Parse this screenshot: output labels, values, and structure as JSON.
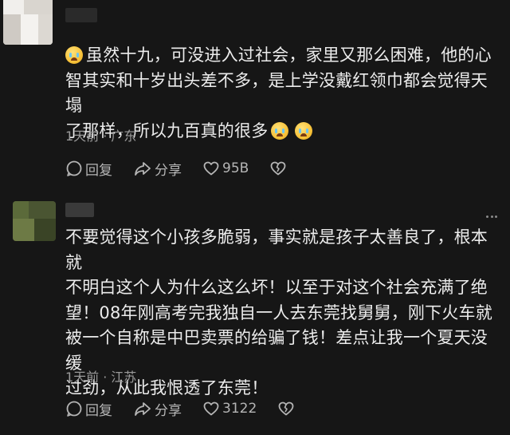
{
  "comments": [
    {
      "lines": [
        "虽然十九，可没进入过社会，家里又那么困难，他的心",
        "智其实和十岁出头差不多，是上学没戴红领巾都会觉得天塌",
        "了那样，所以九百真的很多"
      ],
      "time": "1天前",
      "location": "广东",
      "reply_label": "回复",
      "share_label": "分享",
      "like_count": "95B",
      "emoji_name": "crying-face-icon"
    },
    {
      "lines": [
        "不要觉得这个小孩多脆弱，事实就是孩子太善良了，根本就",
        "不明白这个人为什么这么坏！以至于对这个社会充满了绝",
        "望！08年刚高考完我独自一人去东莞找舅舅，刚下火车就",
        "被一个自称是中巴卖票的给骗了钱！差点让我一个夏天没缓",
        "过劲，从此我恨透了东莞！"
      ],
      "time": "1天前",
      "location": "江苏",
      "reply_label": "回复",
      "share_label": "分享",
      "like_count": "3122"
    }
  ],
  "separator": "·"
}
